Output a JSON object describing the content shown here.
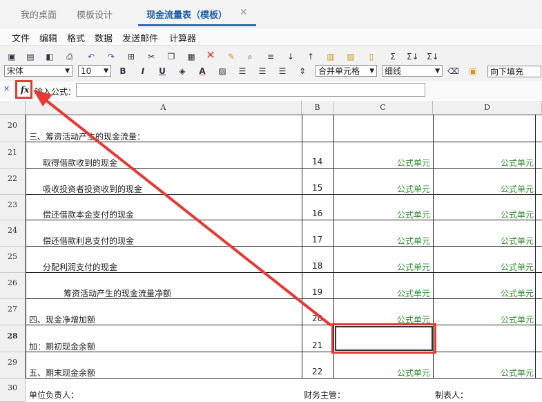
{
  "tabs": [
    {
      "label": "我的桌面"
    },
    {
      "label": "模板设计"
    },
    {
      "label": "现金流量表（模板）",
      "active": true
    }
  ],
  "tab_close": "✕",
  "menu": [
    "文件",
    "编辑",
    "格式",
    "数据",
    "发送邮件",
    "计算器"
  ],
  "toolbar": {
    "font_name": "宋体",
    "font_size": "10",
    "bold": "B",
    "italic": "I",
    "underline": "U",
    "font_color": "A",
    "merge_cells": "合并单元格",
    "border_style": "细线",
    "fill_direction": "向下填充",
    "sum1": "Σ",
    "sum2": "Σ↓",
    "sum3": "Σ↓"
  },
  "formula_bar": {
    "fx_label": "fx",
    "input_label": "输入公式：",
    "value": ""
  },
  "columns": [
    "A",
    "B",
    "C",
    "D"
  ],
  "rows": [
    {
      "num": "20",
      "a": "三、筹资活动产生的现金流量：",
      "b": "",
      "c": "",
      "d": "",
      "indent": 0
    },
    {
      "num": "21",
      "a": "取得借款收到的现金",
      "b": "14",
      "c": "公式单元",
      "d": "公式单元",
      "indent": 1
    },
    {
      "num": "22",
      "a": "吸收投资者投资收到的现金",
      "b": "15",
      "c": "公式单元",
      "d": "公式单元",
      "indent": 1
    },
    {
      "num": "23",
      "a": "偿还借款本金支付的现金",
      "b": "16",
      "c": "公式单元",
      "d": "公式单元",
      "indent": 1
    },
    {
      "num": "24",
      "a": "偿还借款利息支付的现金",
      "b": "17",
      "c": "公式单元",
      "d": "公式单元",
      "indent": 1
    },
    {
      "num": "25",
      "a": "分配利润支付的现金",
      "b": "18",
      "c": "公式单元",
      "d": "公式单元",
      "indent": 1
    },
    {
      "num": "26",
      "a": "筹资活动产生的现金流量净额",
      "b": "19",
      "c": "公式单元",
      "d": "公式单元",
      "indent": 2
    },
    {
      "num": "27",
      "a": "四、现金净增加额",
      "b": "20",
      "c": "公式单元",
      "d": "公式单元",
      "indent": 0
    },
    {
      "num": "28",
      "a": "加：期初现金余额",
      "b": "21",
      "c": "",
      "d": "",
      "indent": 0,
      "selected": true
    },
    {
      "num": "29",
      "a": "五、期末现金余额",
      "b": "22",
      "c": "公式单元",
      "d": "公式单元",
      "indent": 0
    }
  ],
  "footer_row": {
    "num": "30",
    "a": "单位负责人：",
    "b": "财务主管：",
    "d": "制表人："
  },
  "colors": {
    "accent": "#2d6db6",
    "highlight": "#e53935",
    "formula_text": "#2e8b2e"
  }
}
